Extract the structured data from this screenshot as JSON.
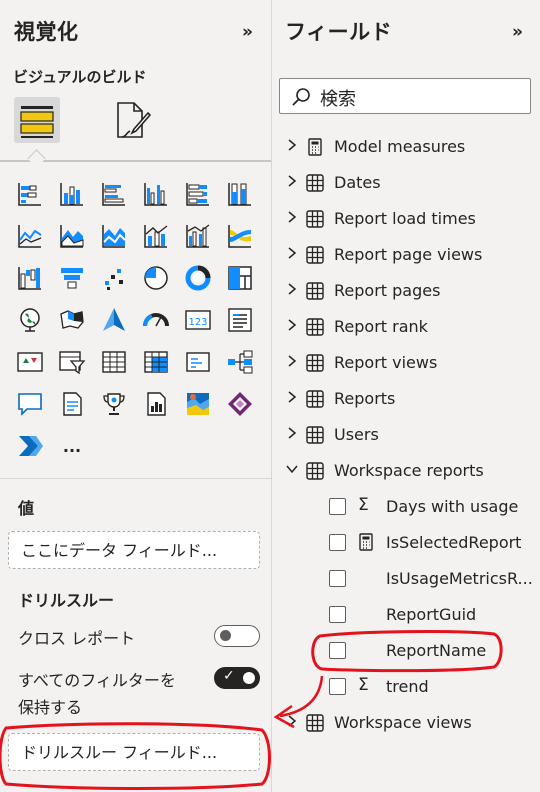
{
  "visualizations": {
    "title": "視覚化",
    "collapse_glyph": "»",
    "build_heading": "ビジュアルのビルド",
    "more_glyph": "...",
    "values_label": "値",
    "values_placeholder": "ここにデータ フィールド...",
    "drillthrough_heading": "ドリルスルー",
    "cross_report_label": "クロス レポート",
    "cross_report_on": false,
    "keep_filters_label_line1": "すべてのフィルターを",
    "keep_filters_label_line2": "保持する",
    "keep_filters_on": true,
    "keep_filters_check": "✓",
    "drillthrough_placeholder": "ドリルスルー フィールド..."
  },
  "fields": {
    "title": "フィールド",
    "collapse_glyph": "»",
    "search_placeholder": "検索",
    "tables": [
      {
        "label": "Model measures",
        "icon": "calculator-icon",
        "expanded": false
      },
      {
        "label": "Dates",
        "icon": "table-icon",
        "expanded": false
      },
      {
        "label": "Report load times",
        "icon": "table-icon",
        "expanded": false
      },
      {
        "label": "Report page views",
        "icon": "table-icon",
        "expanded": false
      },
      {
        "label": "Report pages",
        "icon": "table-icon",
        "expanded": false
      },
      {
        "label": "Report rank",
        "icon": "table-icon",
        "expanded": false
      },
      {
        "label": "Report views",
        "icon": "table-icon",
        "expanded": false
      },
      {
        "label": "Reports",
        "icon": "table-icon",
        "expanded": false
      },
      {
        "label": "Users",
        "icon": "table-icon",
        "expanded": false
      },
      {
        "label": "Workspace reports",
        "icon": "table-icon",
        "expanded": true
      }
    ],
    "workspace_reports_fields": [
      {
        "label": "Days with usage",
        "icon": "sigma-icon",
        "glyph": "Σ"
      },
      {
        "label": "IsSelectedReport",
        "icon": "calculator-icon",
        "glyph": ""
      },
      {
        "label": "IsUsageMetricsR...",
        "icon": "none",
        "glyph": ""
      },
      {
        "label": "ReportGuid",
        "icon": "none",
        "glyph": ""
      },
      {
        "label": "ReportName",
        "icon": "none",
        "glyph": ""
      },
      {
        "label": "trend",
        "icon": "sigma-icon",
        "glyph": "Σ"
      }
    ],
    "last_table": {
      "label": "Workspace views",
      "icon": "table-icon",
      "expanded": false
    }
  },
  "colors": {
    "annotation_red": "#e3121b",
    "powerbi_yellow": "#f2c80f",
    "powerbi_blue": "#118dff",
    "dark_text": "#252423"
  }
}
